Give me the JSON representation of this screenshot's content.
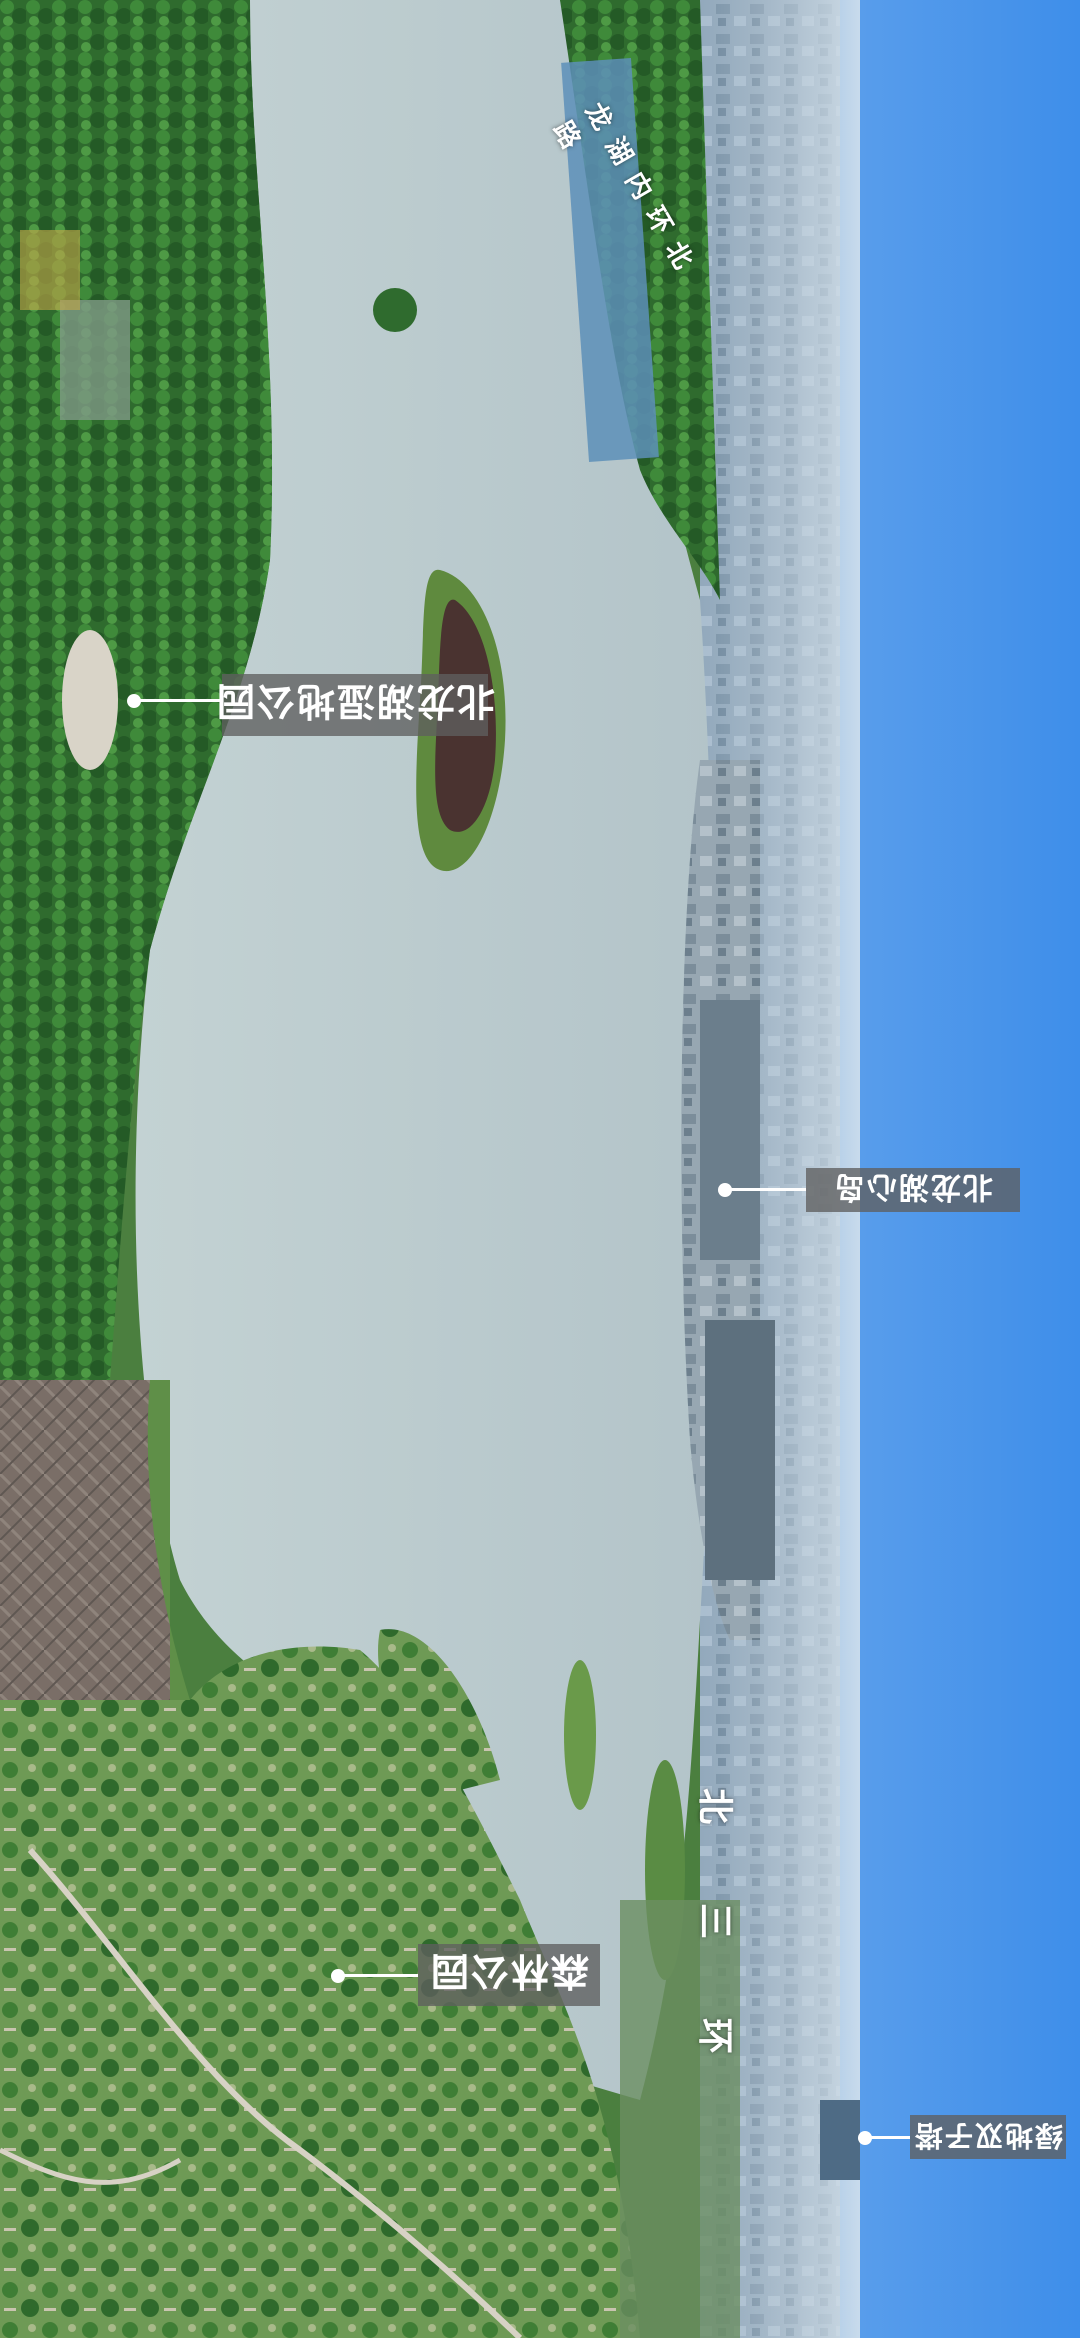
{
  "labels": {
    "wetland_park": "北龙湖湿地公园",
    "heart_island": "北龙湖心岛",
    "forest_park": "森林公园",
    "twin_towers": "绿地双子塔"
  },
  "road_labels": {
    "inner_ring_north": "龙湖内环北路",
    "north_third_ring": [
      "北",
      "三",
      "环"
    ]
  }
}
